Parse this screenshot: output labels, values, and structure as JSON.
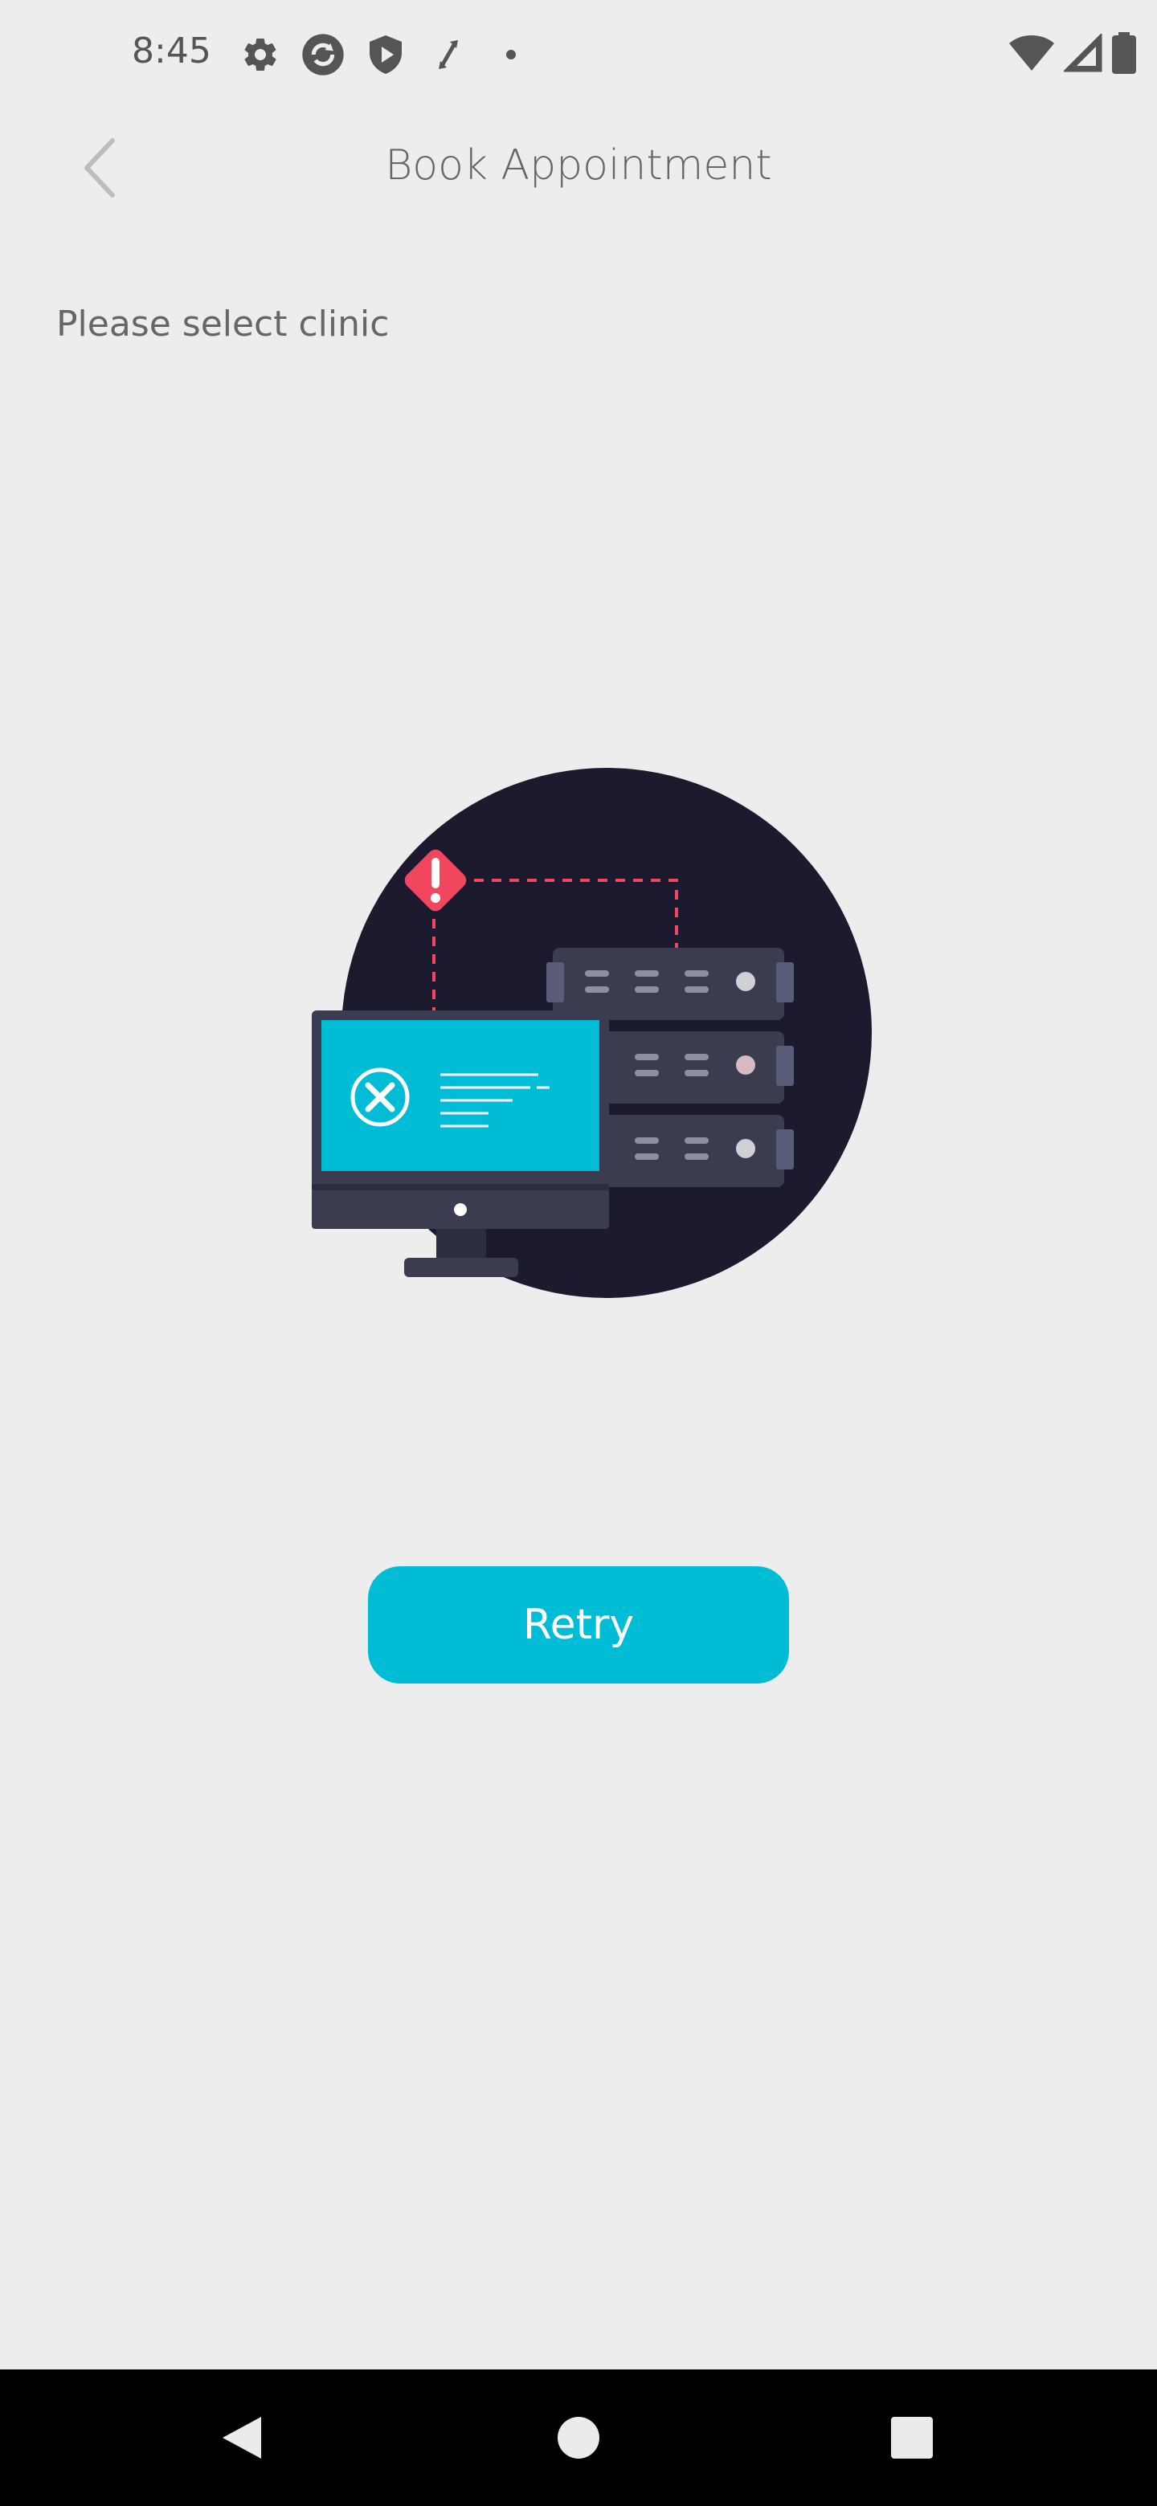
{
  "status_bar": {
    "time": "8:45",
    "left_icons": [
      "gear-icon",
      "sync-icon",
      "shield-play-icon",
      "transfer-icon",
      "dot-icon"
    ],
    "right_icons": [
      "wifi-icon",
      "signal-icon",
      "battery-icon"
    ]
  },
  "header": {
    "title": "Book Appointment",
    "back_icon": "chevron-left-icon"
  },
  "main": {
    "section_label": "Please select clinic",
    "illustration": "connection-error-illustration",
    "retry_label": "Retry"
  },
  "colors": {
    "accent": "#00bcd4",
    "background": "#ededed",
    "circle": "#1b1a2e",
    "warning": "#f2455e"
  },
  "nav_bar": {
    "items": [
      "back-nav-icon",
      "home-nav-icon",
      "recents-nav-icon"
    ]
  }
}
